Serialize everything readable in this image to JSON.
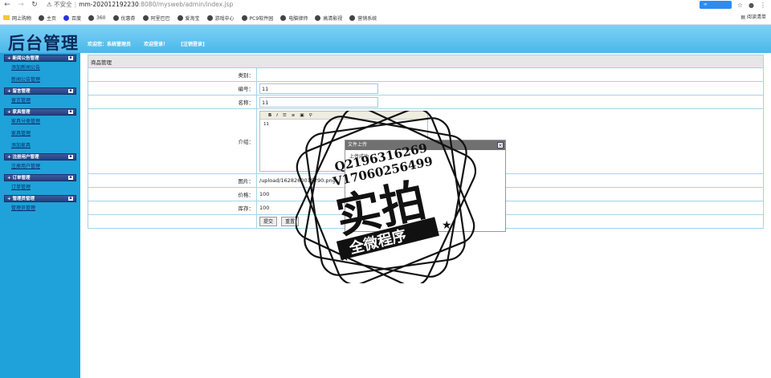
{
  "browser": {
    "security_label": "不安全",
    "url_host": "mm-202012192230",
    "url_path": ":8080/mysweb/admin/index.jsp",
    "bookmarks": [
      "网上购物",
      "主页",
      "百度",
      "360",
      "优惠券",
      "阿里巴巴",
      "爱淘宝",
      "游戏中心",
      "PC9软件园",
      "电脑律师",
      "高清影视",
      "营销系统"
    ],
    "reading_list": "阅读清单"
  },
  "header": {
    "logo": "后台管理",
    "welcome": "欢迎您：系统管理员",
    "login_msg": "欢迎登录！",
    "logout": "[注销登录]"
  },
  "sidebar": [
    {
      "title": "新闻公告管理",
      "items": [
        "添加新闻公告",
        "新闻公告管理"
      ]
    },
    {
      "title": "留言管理",
      "items": [
        "留言管理"
      ]
    },
    {
      "title": "家具管理",
      "items": [
        "家具分类管理",
        "家具管理",
        "添加家具"
      ]
    },
    {
      "title": "注册用户管理",
      "items": [
        "注册用户管理"
      ]
    },
    {
      "title": "订单管理",
      "items": [
        "订单管理"
      ]
    },
    {
      "title": "管理员管理",
      "items": [
        "管理员管理"
      ]
    }
  ],
  "form": {
    "caption": "商品管理",
    "category_label": "类别：",
    "code_label": "编号：",
    "code_value": "11",
    "name_label": "名称：",
    "name_value": "11",
    "intro_label": "介绍：",
    "intro_value": "11",
    "image_label": "图片：",
    "image_value": "/upload/1628260015290.png",
    "price_label": "价格：",
    "price_value": "100",
    "stock_label": "库存：",
    "stock_value": "100",
    "submit": "提交",
    "reset": "重置"
  },
  "dialog": {
    "title": "文件上传",
    "body": "上传成功"
  },
  "watermark": {
    "line1": "Q2196316269",
    "line2": "V17060256499",
    "big": "实拍",
    "banner": "全微程序"
  },
  "colors": {
    "sidebar": "#1ea2d9",
    "header": "#4ab8ea",
    "group": "#22407f"
  }
}
